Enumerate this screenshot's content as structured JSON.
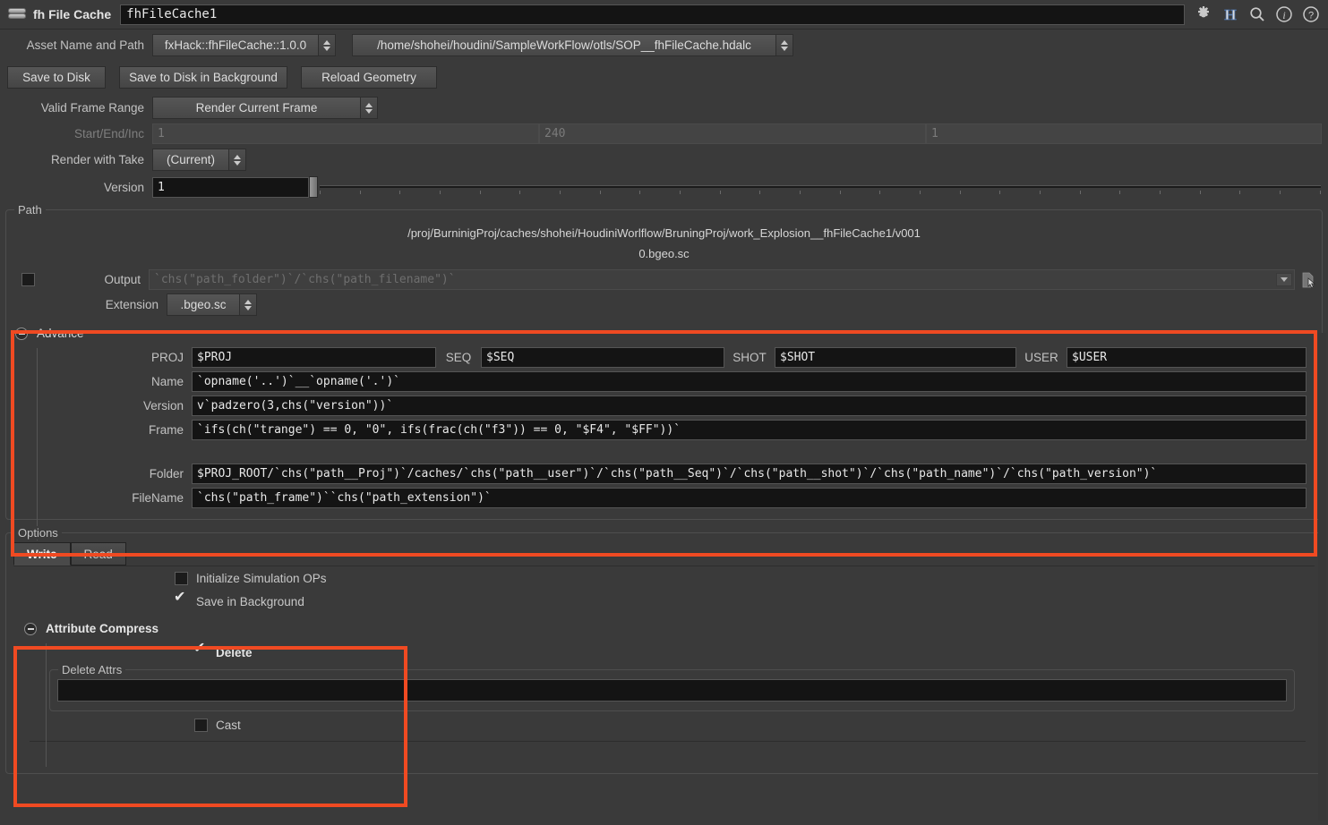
{
  "titlebar": {
    "node_type_label": "fh File Cache",
    "node_name": "fhFileCache1",
    "icons": [
      {
        "name": "gear-icon",
        "label": "gear"
      },
      {
        "name": "houdini-h-icon",
        "label": "H"
      },
      {
        "name": "search-icon",
        "label": "search"
      },
      {
        "name": "info-icon",
        "label": "info"
      },
      {
        "name": "help-icon",
        "label": "help"
      }
    ]
  },
  "asset": {
    "label": "Asset Name and Path",
    "name_value": "fxHack::fhFileCache::1.0.0",
    "path_value": "/home/shohei/houdini/SampleWorkFlow/otls/SOP__fhFileCache.hdalc"
  },
  "buttons": {
    "save_to_disk": "Save to Disk",
    "save_to_disk_bg": "Save to Disk in Background",
    "reload_geometry": "Reload Geometry"
  },
  "frame_range": {
    "label": "Valid Frame Range",
    "value": "Render Current Frame",
    "start_end_inc_label": "Start/End/Inc",
    "start": "1",
    "end": "240",
    "inc": "1"
  },
  "take": {
    "label": "Render with Take",
    "value": "(Current)"
  },
  "version": {
    "label": "Version",
    "value": "1"
  },
  "path_group": {
    "title": "Path",
    "preview_folder": "/proj/BurninigProj/caches/shohei/HoudiniWorlflow/BruningProj/work_Explosion__fhFileCache1/v001",
    "preview_file": "0.bgeo.sc",
    "output_label": "Output",
    "output_value": "`chs(\"path_folder\")`/`chs(\"path_filename\")`",
    "extension_label": "Extension",
    "extension_value": ".bgeo.sc"
  },
  "advance": {
    "title": "Advance",
    "proj_label": "PROJ",
    "proj_value": "$PROJ",
    "seq_label": "SEQ",
    "seq_value": "$SEQ",
    "shot_label": "SHOT",
    "shot_value": "$SHOT",
    "user_label": "USER",
    "user_value": "$USER",
    "name_label": "Name",
    "name_value": "`opname('..')`__`opname('.')`",
    "version_label": "Version",
    "version_value": "v`padzero(3,chs(\"version\"))`",
    "frame_label": "Frame",
    "frame_value": "`ifs(ch(\"trange\") == 0, \"0\", ifs(frac(ch(\"f3\")) == 0, \"$F4\", \"$FF\"))`",
    "folder_label": "Folder",
    "folder_value": "$PROJ_ROOT/`chs(\"path__Proj\")`/caches/`chs(\"path__user\")`/`chs(\"path__Seq\")`/`chs(\"path__shot\")`/`chs(\"path_name\")`/`chs(\"path_version\")`",
    "filename_label": "FileName",
    "filename_value": "`chs(\"path_frame\")``chs(\"path_extension\")`"
  },
  "options": {
    "title": "Options",
    "tabs": [
      {
        "label": "Write",
        "active": true
      },
      {
        "label": "Read",
        "active": false
      }
    ],
    "init_sim_ops_label": "Initialize Simulation OPs",
    "init_sim_ops_checked": false,
    "save_in_background_label": "Save in Background",
    "save_in_background_checked": true
  },
  "attribute_compress": {
    "title": "Attribute Compress",
    "delete_label": "Delete",
    "delete_checked": true,
    "delete_attrs_title": "Delete Attrs",
    "delete_attrs_value": "",
    "cast_label": "Cast",
    "cast_checked": false
  },
  "colors": {
    "highlight": "#f04a22",
    "background": "#3a3a3a",
    "field_bg": "#141414"
  }
}
